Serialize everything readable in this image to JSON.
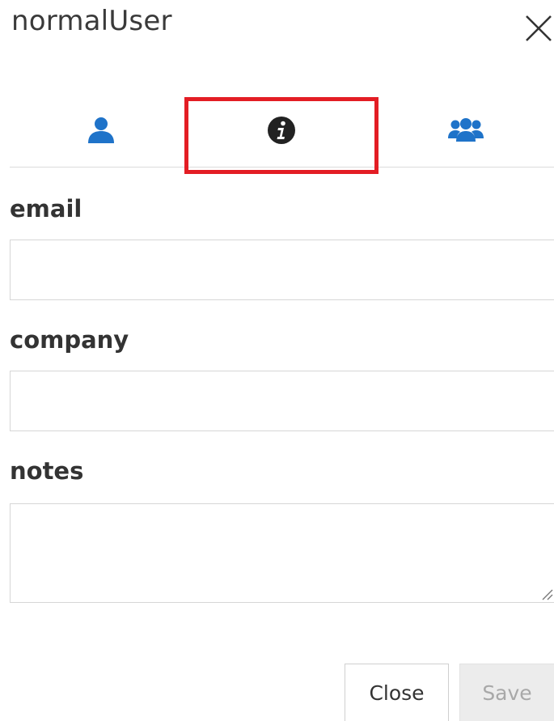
{
  "dialog": {
    "title": "normalUser",
    "close_icon": "close-x-icon"
  },
  "tabs": [
    {
      "icon": "user-icon",
      "color": "#1f73c9"
    },
    {
      "icon": "info-circle-icon",
      "color": "#222222",
      "highlighted": true
    },
    {
      "icon": "users-group-icon",
      "color": "#1f73c9"
    }
  ],
  "highlight_color": "#e31d24",
  "form": {
    "email": {
      "label": "email",
      "value": "",
      "placeholder": ""
    },
    "company": {
      "label": "company",
      "value": "",
      "placeholder": ""
    },
    "notes": {
      "label": "notes",
      "value": "",
      "placeholder": ""
    }
  },
  "buttons": {
    "close_label": "Close",
    "save_label": "Save",
    "save_disabled": true
  }
}
